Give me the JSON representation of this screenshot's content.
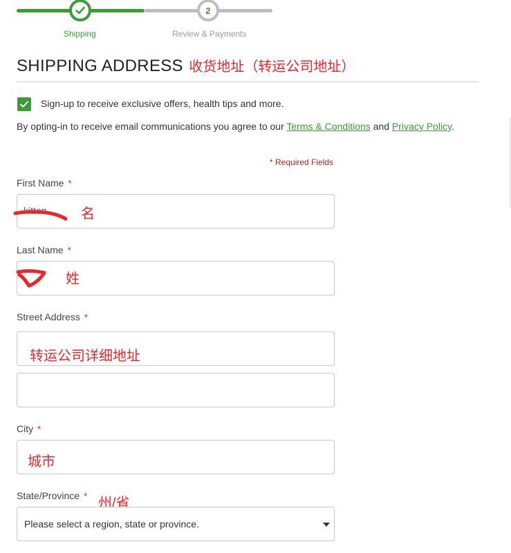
{
  "progress": {
    "step1_label": "Shipping",
    "step2_label": "Review & Payments",
    "step2_number": "2",
    "colors": {
      "accent": "#3c9a37",
      "inactive": "#bdbdbd"
    }
  },
  "section": {
    "title": "SHIPPING ADDRESS",
    "title_annotation": "收货地址（转运公司地址）"
  },
  "optin": {
    "checkbox_label": "Sign-up to receive exclusive offers, health tips and more.",
    "checked": true,
    "consent_prefix": "By opting-in to receive email communications you agree to our",
    "terms_link": "Terms & Conditions",
    "and_text": "and",
    "privacy_link": "Privacy Policy",
    "period": "."
  },
  "form": {
    "required_note": "* Required Fields",
    "first_name": {
      "label": "First Name",
      "star": "*",
      "value": "kitten",
      "annotation": "名"
    },
    "last_name": {
      "label": "Last Name",
      "star": "*",
      "annotation": "姓"
    },
    "street": {
      "label": "Street Address",
      "star": "*",
      "annotation": "转运公司详细地址"
    },
    "city": {
      "label": "City",
      "star": "*",
      "annotation": "城市"
    },
    "state": {
      "label": "State/Province",
      "star": "*",
      "annotation": "州/省",
      "selected": "Please select a region, state or province."
    }
  }
}
